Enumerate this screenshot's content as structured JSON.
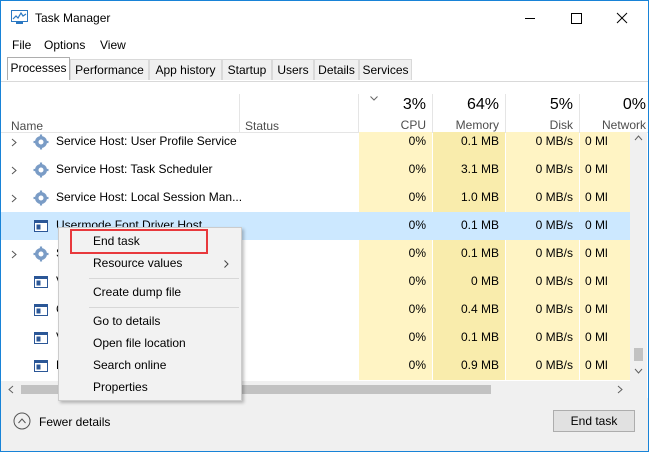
{
  "window": {
    "title": "Task Manager"
  },
  "menu": [
    "File",
    "Options",
    "View"
  ],
  "tabs": [
    "Processes",
    "Performance",
    "App history",
    "Startup",
    "Users",
    "Details",
    "Services"
  ],
  "columns": {
    "name": "Name",
    "status": "Status",
    "cpu": {
      "pct": "3%",
      "label": "CPU"
    },
    "memory": {
      "pct": "64%",
      "label": "Memory"
    },
    "disk": {
      "pct": "5%",
      "label": "Disk"
    },
    "network": {
      "pct": "0%",
      "label": "Network"
    }
  },
  "rows": [
    {
      "name": "Service Host: User Profile Service",
      "expandable": true,
      "icon": "gear-icon",
      "cpu": "0%",
      "memory": "0.1 MB",
      "disk": "0 MB/s",
      "network": "0 Ml"
    },
    {
      "name": "Service Host: Task Scheduler",
      "expandable": true,
      "icon": "gear-icon",
      "cpu": "0%",
      "memory": "3.1 MB",
      "disk": "0 MB/s",
      "network": "0 Ml"
    },
    {
      "name": "Service Host: Local Session Man...",
      "expandable": true,
      "icon": "gear-icon",
      "cpu": "0%",
      "memory": "1.0 MB",
      "disk": "0 MB/s",
      "network": "0 Ml"
    },
    {
      "name": "Usermode Font Driver Host",
      "expandable": false,
      "icon": "window-icon",
      "cpu": "0%",
      "memory": "0.1 MB",
      "disk": "0 MB/s",
      "network": "0 Ml",
      "selected": true
    },
    {
      "name": "S",
      "expandable": true,
      "icon": "gear-icon",
      "cpu": "0%",
      "memory": "0.1 MB",
      "disk": "0 MB/s",
      "network": "0 Ml"
    },
    {
      "name": "V",
      "expandable": false,
      "icon": "window-icon",
      "cpu": "0%",
      "memory": "0 MB",
      "disk": "0 MB/s",
      "network": "0 Ml"
    },
    {
      "name": "C",
      "expandable": false,
      "icon": "window-icon",
      "cpu": "0%",
      "memory": "0.4 MB",
      "disk": "0 MB/s",
      "network": "0 Ml"
    },
    {
      "name": "V",
      "expandable": false,
      "icon": "window-icon",
      "cpu": "0%",
      "memory": "0.1 MB",
      "disk": "0 MB/s",
      "network": "0 Ml"
    },
    {
      "name": "F",
      "expandable": false,
      "icon": "window-icon",
      "cpu": "0%",
      "memory": "0.9 MB",
      "disk": "0 MB/s",
      "network": "0 Ml"
    }
  ],
  "context_menu": {
    "end_task": "End task",
    "resource_values": "Resource values",
    "create_dump": "Create dump file",
    "go_to_details": "Go to details",
    "open_file_location": "Open file location",
    "search_online": "Search online",
    "properties": "Properties"
  },
  "footer": {
    "fewer_details": "Fewer details",
    "end_task": "End task"
  },
  "colors": {
    "accent": "#1883d7",
    "cpu_col": "#fff4c4",
    "mem_col": "#f9ecac",
    "selected": "#cce8ff",
    "highlight_box": "#e8393d"
  }
}
